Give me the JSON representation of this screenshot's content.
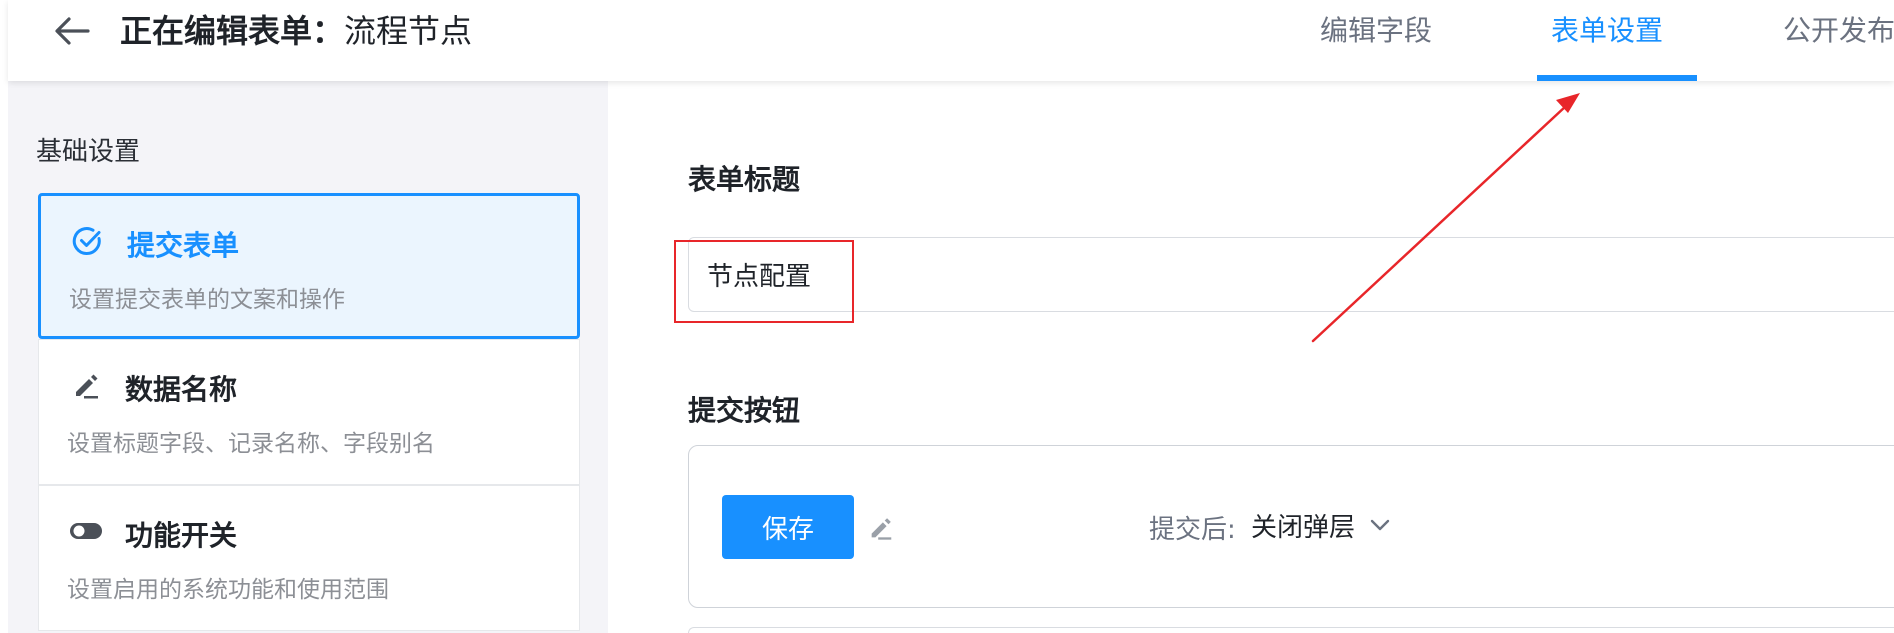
{
  "header": {
    "title_prefix": "正在编辑表单：",
    "title_name": "流程节点",
    "tabs": [
      {
        "label": "编辑字段"
      },
      {
        "label": "表单设置"
      },
      {
        "label": "公开发布"
      }
    ],
    "active_tab": "表单设置"
  },
  "sidebar": {
    "heading": "基础设置",
    "items": [
      {
        "label": "提交表单",
        "desc": "设置提交表单的文案和操作",
        "icon": "check-circle-icon"
      },
      {
        "label": "数据名称",
        "desc": "设置标题字段、记录名称、字段别名",
        "icon": "pencil-icon"
      },
      {
        "label": "功能开关",
        "desc": "设置启用的系统功能和使用范围",
        "icon": "toggle-icon"
      }
    ],
    "active_item": "提交表单"
  },
  "main": {
    "form_title_label": "表单标题",
    "form_title_value": "节点配置",
    "submit_button_label": "提交按钮",
    "save_label": "保存",
    "after_submit_label": "提交后:",
    "after_submit_value": "关闭弹层"
  },
  "colors": {
    "accent": "#1890ff",
    "annotation_red": "#e8262a",
    "sidebar_bg": "#f4f4f8"
  }
}
